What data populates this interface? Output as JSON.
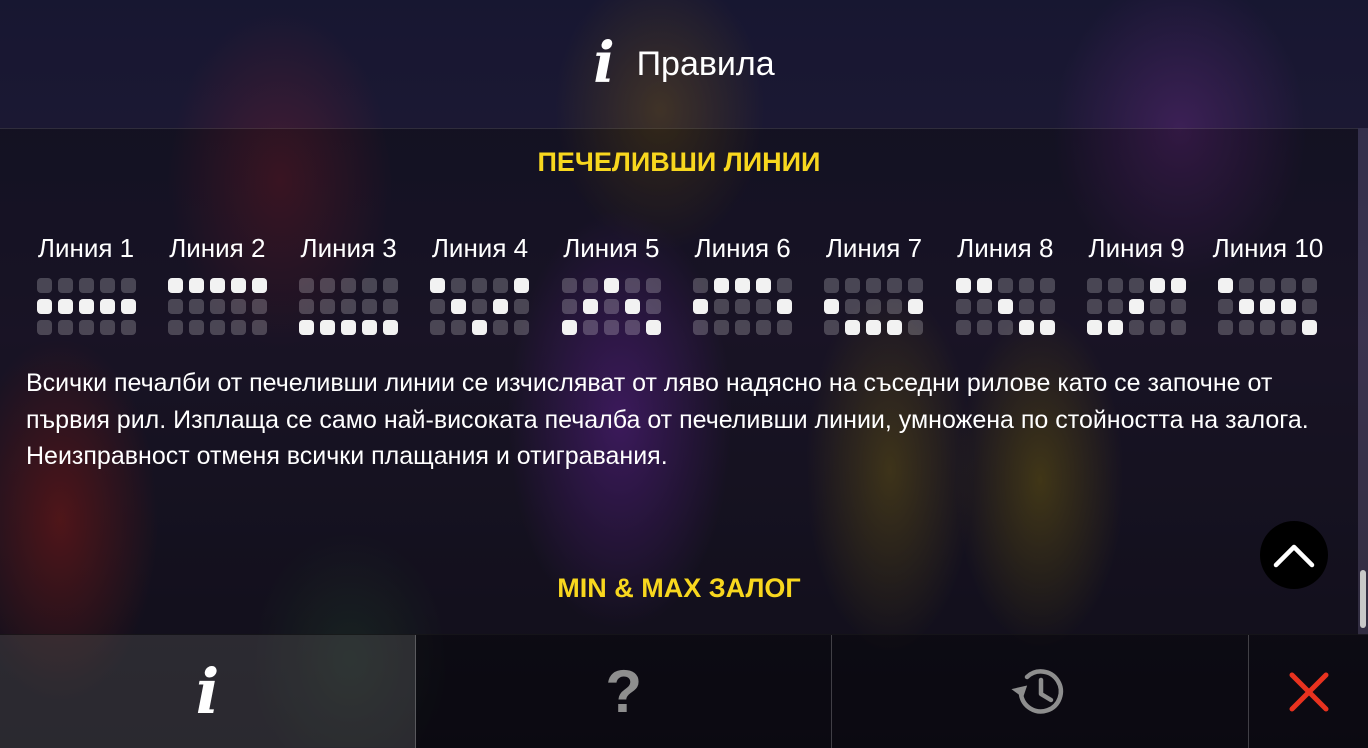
{
  "header": {
    "icon": "info-icon",
    "glyph": "i",
    "title": "Правила"
  },
  "winlines": {
    "title": "ПЕЧЕЛИВШИ ЛИНИИ",
    "lines": [
      {
        "label": "Линия 1",
        "rows": [
          1,
          1,
          1,
          1,
          1
        ]
      },
      {
        "label": "Линия 2",
        "rows": [
          0,
          0,
          0,
          0,
          0
        ]
      },
      {
        "label": "Линия 3",
        "rows": [
          2,
          2,
          2,
          2,
          2
        ]
      },
      {
        "label": "Линия 4",
        "rows": [
          0,
          1,
          2,
          1,
          0
        ]
      },
      {
        "label": "Линия 5",
        "rows": [
          2,
          1,
          0,
          1,
          2
        ]
      },
      {
        "label": "Линия 6",
        "rows": [
          1,
          0,
          0,
          0,
          1
        ]
      },
      {
        "label": "Линия 7",
        "rows": [
          1,
          2,
          2,
          2,
          1
        ]
      },
      {
        "label": "Линия 8",
        "rows": [
          0,
          0,
          1,
          2,
          2
        ]
      },
      {
        "label": "Линия 9",
        "rows": [
          2,
          2,
          1,
          0,
          0
        ]
      },
      {
        "label": "Линия 10",
        "rows": [
          0,
          1,
          1,
          1,
          2
        ]
      }
    ]
  },
  "rules": {
    "paragraph1": "Всички печалби от печеливши линии се изчисляват от ляво надясно на съседни рилове като се започне от първия рил. Изплаща се само най-високата печалба от печеливши линии, умножена по стойността на залога.",
    "paragraph2": "Неизправност отменя всички плащания и отигравания."
  },
  "bets": {
    "title": "MIN & MAX ЗАЛОГ"
  },
  "scroll_up": {
    "icon": "chevron-up-icon"
  },
  "footer": {
    "tabs": [
      {
        "id": "info",
        "icon": "info-icon",
        "glyph": "i",
        "active": true
      },
      {
        "id": "help",
        "icon": "help-icon",
        "glyph": "?",
        "active": false
      },
      {
        "id": "history",
        "icon": "history-icon",
        "active": false
      },
      {
        "id": "close",
        "icon": "close-icon",
        "active": false
      }
    ]
  },
  "colors": {
    "accent": "#f8d71e",
    "close": "#e8321f",
    "dot_on": "#f2f2f2",
    "muted_icon": "#8e8e8e"
  }
}
